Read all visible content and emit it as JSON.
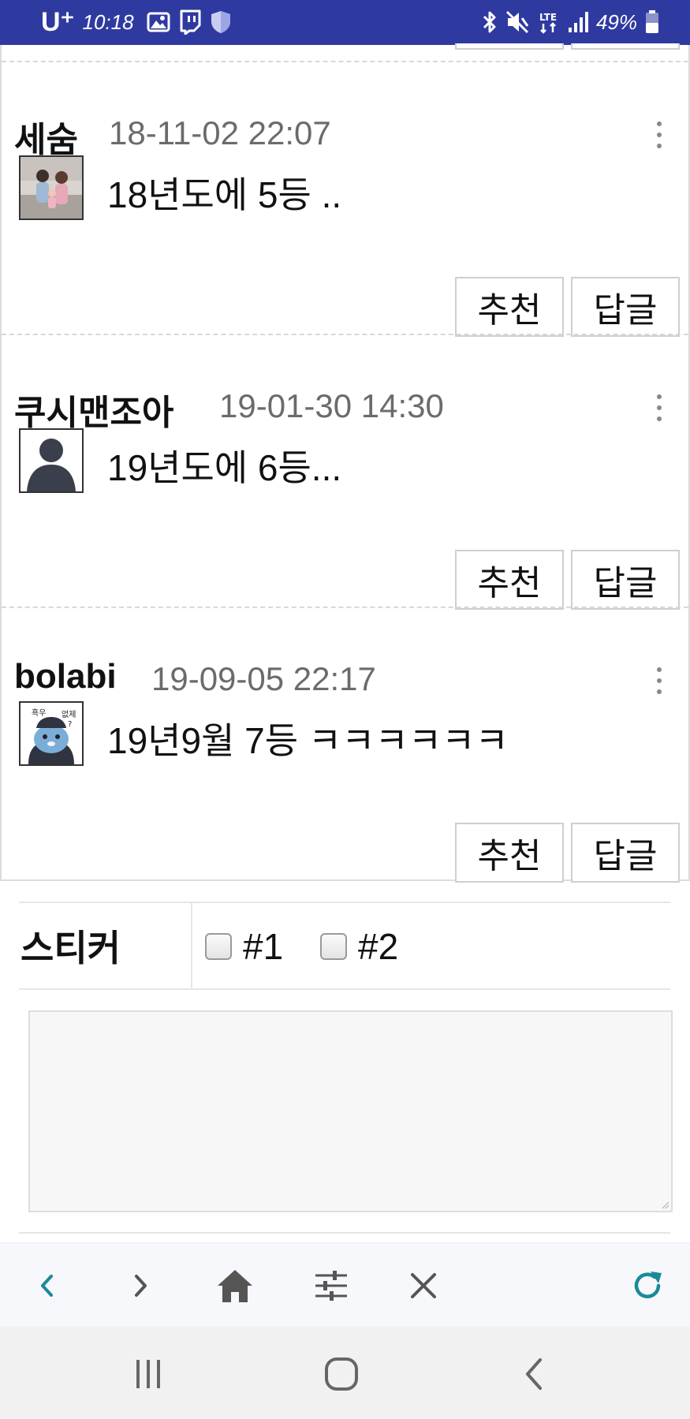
{
  "status_bar": {
    "carrier": "U⁺",
    "time": "10:18",
    "battery": "49%",
    "icons": [
      "gallery-icon",
      "twitch-icon",
      "shield-icon",
      "bluetooth-icon",
      "mute-icon",
      "lte-icon",
      "signal-icon",
      "battery-icon"
    ]
  },
  "comments": [
    {
      "author": "세숨",
      "date": "18-11-02 22:07",
      "text": "18년도에 5등 ..",
      "avatar": "photo-avatar",
      "recommend_label": "추천",
      "reply_label": "답글"
    },
    {
      "author": "쿠시맨조아",
      "date": "19-01-30 14:30",
      "text": "19년도에 6등...",
      "avatar": "default-avatar",
      "recommend_label": "추천",
      "reply_label": "답글"
    },
    {
      "author": "bolabi",
      "date": "19-09-05 22:17",
      "text": "19년9월 7등 ㅋㅋㅋㅋㅋㅋ",
      "avatar": "character-avatar",
      "avatar_text_1": "흑우",
      "avatar_text_2": "없제",
      "avatar_text_3": "?",
      "recommend_label": "추천",
      "reply_label": "답글"
    }
  ],
  "sticker": {
    "label": "스티커",
    "options": [
      "#1",
      "#2"
    ],
    "checked": [
      false,
      false
    ]
  },
  "comment_input": {
    "value": "",
    "placeholder": ""
  },
  "browser_toolbar": {
    "icons": [
      "back-icon",
      "forward-icon",
      "home-icon",
      "settings-sliders-icon",
      "close-icon",
      "refresh-icon"
    ],
    "accent_color": "#1a8a9a"
  },
  "nav_bar": {
    "icons": [
      "recent-apps-icon",
      "home-circle-icon",
      "back-chevron-icon"
    ]
  },
  "colors": {
    "status_bar_bg": "#2f3aa0",
    "date_text": "#6b6b6b",
    "toolbar_bg": "#f7f8fb",
    "navbar_bg": "#f1f1f1"
  }
}
